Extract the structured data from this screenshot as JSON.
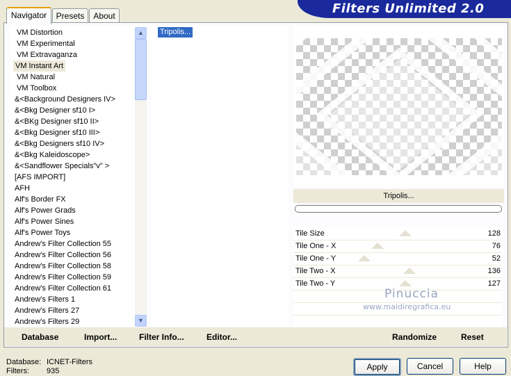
{
  "app": {
    "title": "Filters Unlimited 2.0",
    "tabs": [
      "Navigator",
      "Presets",
      "About"
    ]
  },
  "categories": [
    "VM Distortion",
    "VM Experimental",
    "VM Extravaganza",
    "VM Instant Art",
    "VM Natural",
    "VM Toolbox",
    "&<Background Designers IV>",
    "&<Bkg Designer sf10 I>",
    "&<BKg Designer sf10 II>",
    "&<Bkg Designer sf10 III>",
    "&<Bkg Designers sf10 IV>",
    "&<Bkg Kaleidoscope>",
    "&<Sandflower Specials\"v\" >",
    "[AFS IMPORT]",
    "AFH",
    "Alf's Border FX",
    "Alf's Power Grads",
    "Alf's Power Sines",
    "Alf's Power Toys",
    "Andrew's Filter Collection 55",
    "Andrew's Filter Collection 56",
    "Andrew's Filter Collection 58",
    "Andrew's Filter Collection 59",
    "Andrew's Filter Collection 61",
    "Andrew's Filters 1",
    "Andrew's Filters 27",
    "Andrew's Filters 29"
  ],
  "selected_category": "VM Instant Art",
  "filters": [
    "Tripolis..."
  ],
  "selected_filter": "Tripolis...",
  "preview_label": "Tripolis...",
  "progress": 0,
  "parameters": [
    {
      "label": "Tile Size",
      "value": "128",
      "level": 0.5
    },
    {
      "label": "Tile One - X",
      "value": "76",
      "level": 0.3
    },
    {
      "label": "Tile One - Y",
      "value": "52",
      "level": 0.2
    },
    {
      "label": "Tile Two - X",
      "value": "136",
      "level": 0.53
    },
    {
      "label": "Tile Two - Y",
      "value": "127",
      "level": 0.5
    }
  ],
  "watermark": {
    "name": "Pinuccia",
    "url": "www.maidiregrafica.eu"
  },
  "bottom_buttons": {
    "database": "Database",
    "import": "Import...",
    "filter_info": "Filter Info...",
    "editor": "Editor...",
    "randomize": "Randomize",
    "reset": "Reset"
  },
  "status": {
    "database_label": "Database:",
    "database_value": "ICNET-Filters",
    "filters_label": "Filters:",
    "filters_value": "935"
  },
  "dialog_buttons": {
    "apply": "Apply",
    "cancel": "Cancel",
    "help": "Help"
  },
  "icons": {
    "scroll_up": "▲",
    "scroll_down": "▼"
  },
  "colors": {
    "banner": "#1a2a9c",
    "selection": "#316ac5",
    "watermark": "#9aa6c2"
  }
}
